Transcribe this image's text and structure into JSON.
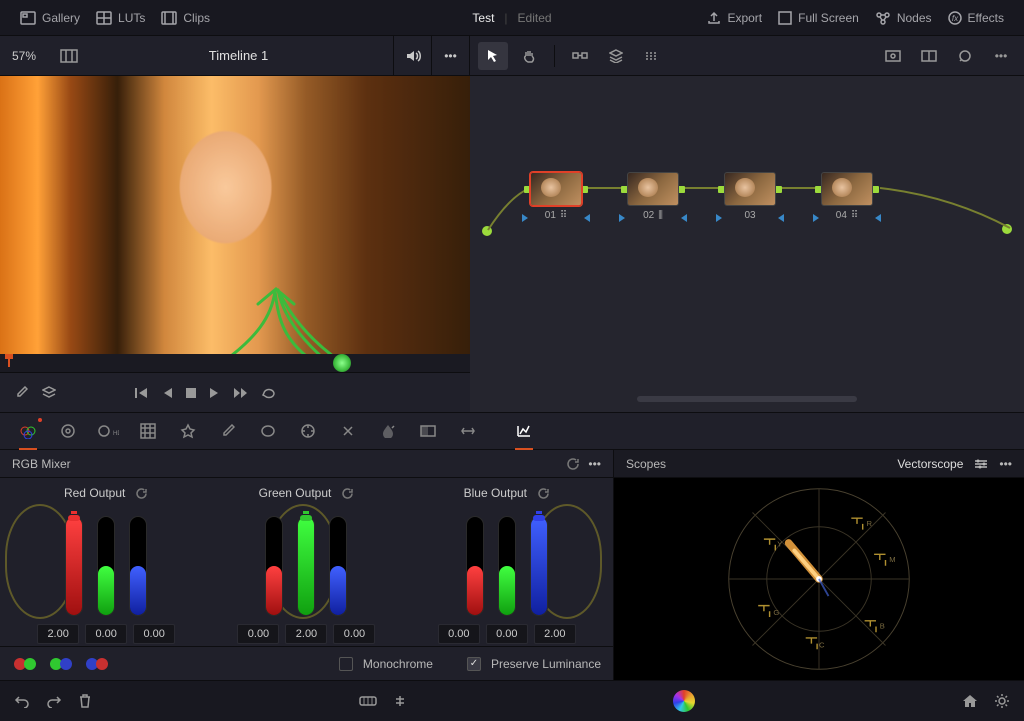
{
  "topbar": {
    "gallery": "Gallery",
    "luts": "LUTs",
    "clips": "Clips",
    "project_name": "Test",
    "project_status": "Edited",
    "export": "Export",
    "fullscreen": "Full Screen",
    "nodes": "Nodes",
    "effects": "Effects"
  },
  "viewer": {
    "zoom": "57%",
    "timeline_name": "Timeline 1"
  },
  "node_graph": {
    "nodes": [
      {
        "id": "01",
        "selected": true
      },
      {
        "id": "02",
        "selected": false
      },
      {
        "id": "03",
        "selected": false
      },
      {
        "id": "04",
        "selected": false
      }
    ]
  },
  "mixer": {
    "title": "RGB Mixer",
    "channels": [
      {
        "name": "Red Output",
        "values": [
          "2.00",
          "0.00",
          "0.00"
        ],
        "boost_index": 0
      },
      {
        "name": "Green Output",
        "values": [
          "0.00",
          "2.00",
          "0.00"
        ],
        "boost_index": 1
      },
      {
        "name": "Blue Output",
        "values": [
          "0.00",
          "0.00",
          "2.00"
        ],
        "boost_index": 2
      }
    ],
    "monochrome_label": "Monochrome",
    "monochrome_checked": false,
    "preserve_label": "Preserve Luminance",
    "preserve_checked": true
  },
  "scopes": {
    "title": "Scopes",
    "type": "Vectorscope"
  }
}
